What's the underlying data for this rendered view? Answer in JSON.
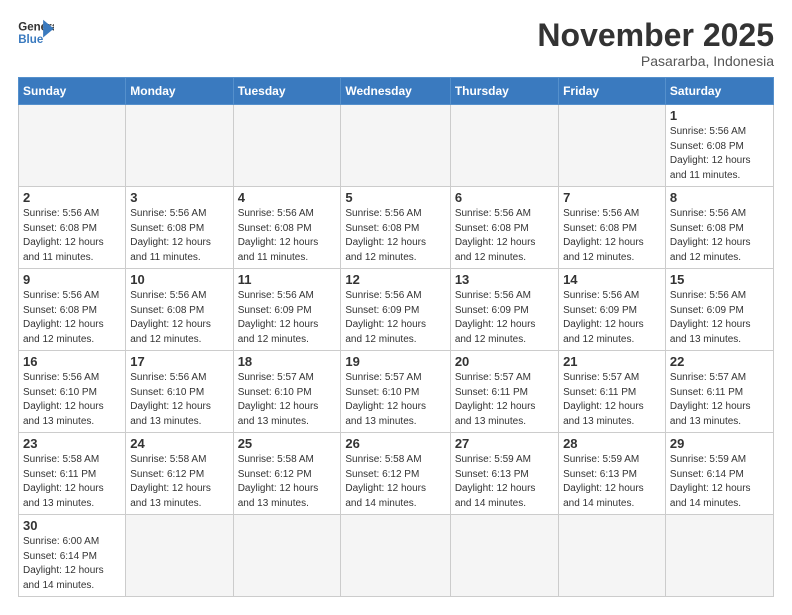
{
  "logo": {
    "line1": "General",
    "line2": "Blue"
  },
  "title": "November 2025",
  "subtitle": "Pasararba, Indonesia",
  "days_header": [
    "Sunday",
    "Monday",
    "Tuesday",
    "Wednesday",
    "Thursday",
    "Friday",
    "Saturday"
  ],
  "weeks": [
    [
      {
        "day": "",
        "info": ""
      },
      {
        "day": "",
        "info": ""
      },
      {
        "day": "",
        "info": ""
      },
      {
        "day": "",
        "info": ""
      },
      {
        "day": "",
        "info": ""
      },
      {
        "day": "",
        "info": ""
      },
      {
        "day": "1",
        "info": "Sunrise: 5:56 AM\nSunset: 6:08 PM\nDaylight: 12 hours\nand 11 minutes."
      }
    ],
    [
      {
        "day": "2",
        "info": "Sunrise: 5:56 AM\nSunset: 6:08 PM\nDaylight: 12 hours\nand 11 minutes."
      },
      {
        "day": "3",
        "info": "Sunrise: 5:56 AM\nSunset: 6:08 PM\nDaylight: 12 hours\nand 11 minutes."
      },
      {
        "day": "4",
        "info": "Sunrise: 5:56 AM\nSunset: 6:08 PM\nDaylight: 12 hours\nand 11 minutes."
      },
      {
        "day": "5",
        "info": "Sunrise: 5:56 AM\nSunset: 6:08 PM\nDaylight: 12 hours\nand 12 minutes."
      },
      {
        "day": "6",
        "info": "Sunrise: 5:56 AM\nSunset: 6:08 PM\nDaylight: 12 hours\nand 12 minutes."
      },
      {
        "day": "7",
        "info": "Sunrise: 5:56 AM\nSunset: 6:08 PM\nDaylight: 12 hours\nand 12 minutes."
      },
      {
        "day": "8",
        "info": "Sunrise: 5:56 AM\nSunset: 6:08 PM\nDaylight: 12 hours\nand 12 minutes."
      }
    ],
    [
      {
        "day": "9",
        "info": "Sunrise: 5:56 AM\nSunset: 6:08 PM\nDaylight: 12 hours\nand 12 minutes."
      },
      {
        "day": "10",
        "info": "Sunrise: 5:56 AM\nSunset: 6:08 PM\nDaylight: 12 hours\nand 12 minutes."
      },
      {
        "day": "11",
        "info": "Sunrise: 5:56 AM\nSunset: 6:09 PM\nDaylight: 12 hours\nand 12 minutes."
      },
      {
        "day": "12",
        "info": "Sunrise: 5:56 AM\nSunset: 6:09 PM\nDaylight: 12 hours\nand 12 minutes."
      },
      {
        "day": "13",
        "info": "Sunrise: 5:56 AM\nSunset: 6:09 PM\nDaylight: 12 hours\nand 12 minutes."
      },
      {
        "day": "14",
        "info": "Sunrise: 5:56 AM\nSunset: 6:09 PM\nDaylight: 12 hours\nand 12 minutes."
      },
      {
        "day": "15",
        "info": "Sunrise: 5:56 AM\nSunset: 6:09 PM\nDaylight: 12 hours\nand 13 minutes."
      }
    ],
    [
      {
        "day": "16",
        "info": "Sunrise: 5:56 AM\nSunset: 6:10 PM\nDaylight: 12 hours\nand 13 minutes."
      },
      {
        "day": "17",
        "info": "Sunrise: 5:56 AM\nSunset: 6:10 PM\nDaylight: 12 hours\nand 13 minutes."
      },
      {
        "day": "18",
        "info": "Sunrise: 5:57 AM\nSunset: 6:10 PM\nDaylight: 12 hours\nand 13 minutes."
      },
      {
        "day": "19",
        "info": "Sunrise: 5:57 AM\nSunset: 6:10 PM\nDaylight: 12 hours\nand 13 minutes."
      },
      {
        "day": "20",
        "info": "Sunrise: 5:57 AM\nSunset: 6:11 PM\nDaylight: 12 hours\nand 13 minutes."
      },
      {
        "day": "21",
        "info": "Sunrise: 5:57 AM\nSunset: 6:11 PM\nDaylight: 12 hours\nand 13 minutes."
      },
      {
        "day": "22",
        "info": "Sunrise: 5:57 AM\nSunset: 6:11 PM\nDaylight: 12 hours\nand 13 minutes."
      }
    ],
    [
      {
        "day": "23",
        "info": "Sunrise: 5:58 AM\nSunset: 6:11 PM\nDaylight: 12 hours\nand 13 minutes."
      },
      {
        "day": "24",
        "info": "Sunrise: 5:58 AM\nSunset: 6:12 PM\nDaylight: 12 hours\nand 13 minutes."
      },
      {
        "day": "25",
        "info": "Sunrise: 5:58 AM\nSunset: 6:12 PM\nDaylight: 12 hours\nand 13 minutes."
      },
      {
        "day": "26",
        "info": "Sunrise: 5:58 AM\nSunset: 6:12 PM\nDaylight: 12 hours\nand 14 minutes."
      },
      {
        "day": "27",
        "info": "Sunrise: 5:59 AM\nSunset: 6:13 PM\nDaylight: 12 hours\nand 14 minutes."
      },
      {
        "day": "28",
        "info": "Sunrise: 5:59 AM\nSunset: 6:13 PM\nDaylight: 12 hours\nand 14 minutes."
      },
      {
        "day": "29",
        "info": "Sunrise: 5:59 AM\nSunset: 6:14 PM\nDaylight: 12 hours\nand 14 minutes."
      }
    ],
    [
      {
        "day": "30",
        "info": "Sunrise: 6:00 AM\nSunset: 6:14 PM\nDaylight: 12 hours\nand 14 minutes."
      },
      {
        "day": "",
        "info": ""
      },
      {
        "day": "",
        "info": ""
      },
      {
        "day": "",
        "info": ""
      },
      {
        "day": "",
        "info": ""
      },
      {
        "day": "",
        "info": ""
      },
      {
        "day": "",
        "info": ""
      }
    ]
  ]
}
